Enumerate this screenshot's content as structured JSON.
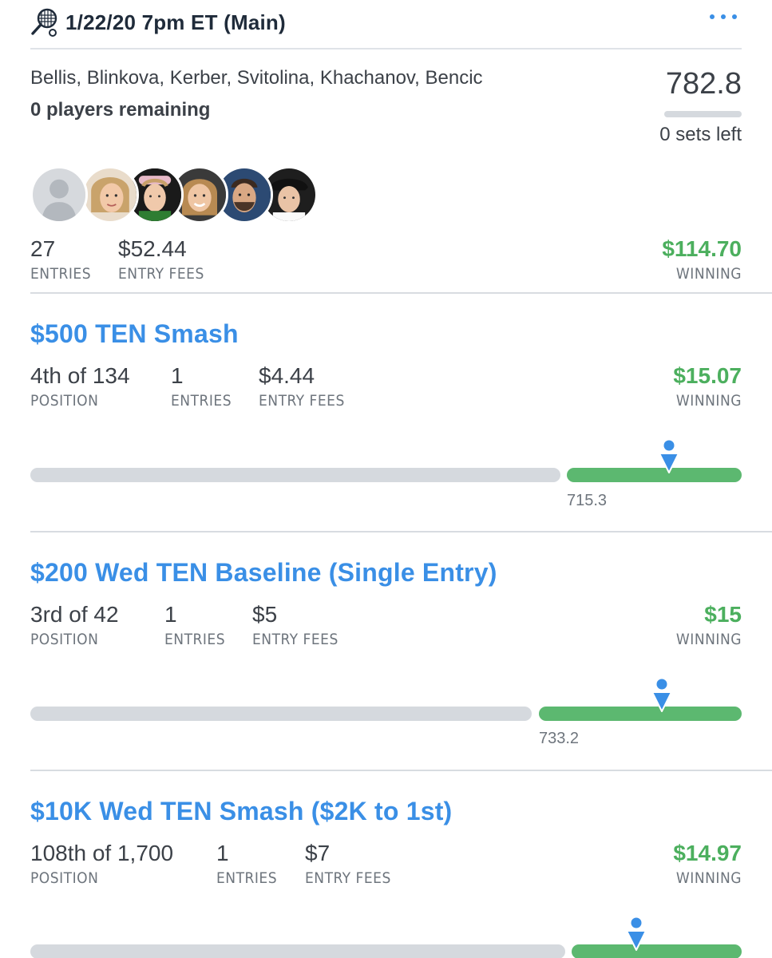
{
  "header": {
    "title": "1/22/20 7pm ET (Main)",
    "icon": "tennis-racket-icon",
    "more_icon": "more-dots-icon"
  },
  "lineup": {
    "players": "Bellis, Blinkova, Kerber, Svitolina, Khachanov, Bencic",
    "remaining": "0 players remaining",
    "score": "782.8",
    "sets_left": "0 sets left",
    "entries_value": "27",
    "entries_label": "ENTRIES",
    "fees_value": "$52.44",
    "fees_label": "ENTRY FEES",
    "winning_value": "$114.70",
    "winning_label": "WINNING"
  },
  "contests": [
    {
      "title": "$500 TEN Smash",
      "position_value": "4th of 134",
      "position_label": "POSITION",
      "entries_value": "1",
      "entries_label": "ENTRIES",
      "fees_value": "$4.44",
      "fees_label": "ENTRY FEES",
      "winning_value": "$15.07",
      "winning_label": "WINNING",
      "cash_line": "715.3"
    },
    {
      "title": "$200 Wed TEN Baseline (Single Entry)",
      "position_value": "3rd of 42",
      "position_label": "POSITION",
      "entries_value": "1",
      "entries_label": "ENTRIES",
      "fees_value": "$5",
      "fees_label": "ENTRY FEES",
      "winning_value": "$15",
      "winning_label": "WINNING",
      "cash_line": "733.2"
    },
    {
      "title": "$10K Wed TEN Smash ($2K to 1st)",
      "position_value": "108th of 1,700",
      "position_label": "POSITION",
      "entries_value": "1",
      "entries_label": "ENTRIES",
      "fees_value": "$7",
      "fees_label": "ENTRY FEES",
      "winning_value": "$14.97",
      "winning_label": "WINNING"
    }
  ],
  "colors": {
    "accent_blue": "#3a8fe6",
    "winning_green": "#4caf5e",
    "bar_green": "#5cb870",
    "bar_gray": "#d5d9de"
  }
}
